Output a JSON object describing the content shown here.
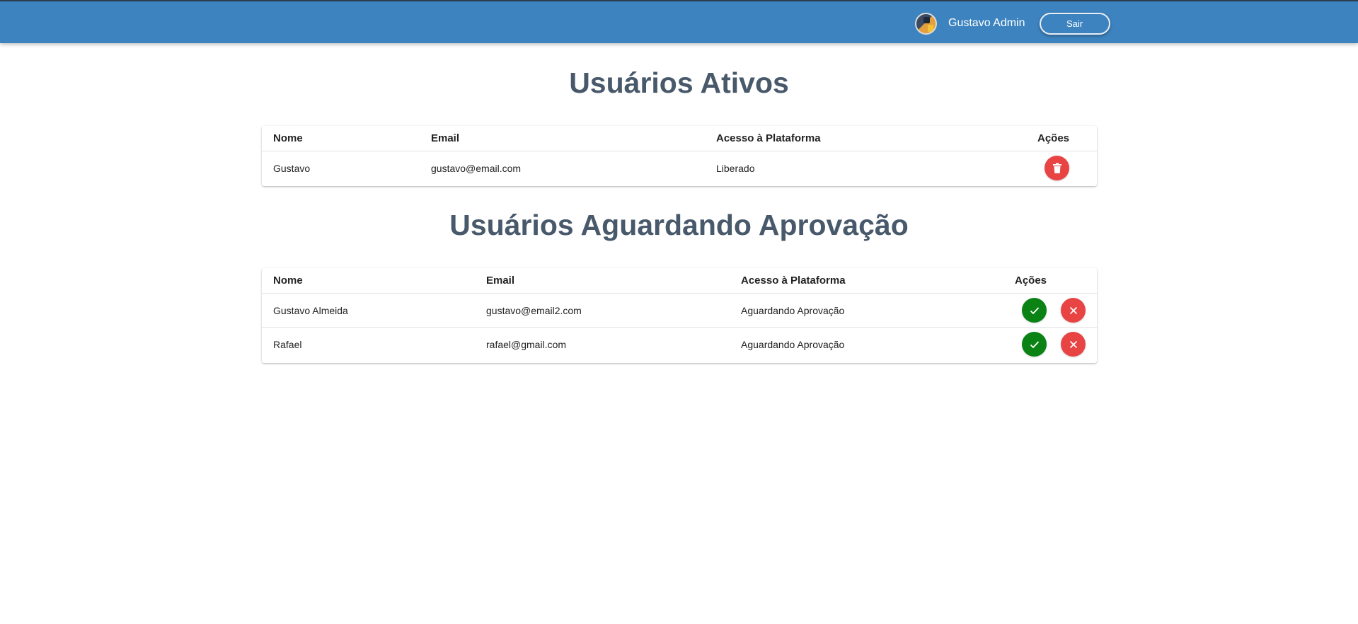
{
  "header": {
    "user_name": "Gustavo Admin",
    "logout_label": "Sair"
  },
  "active_users": {
    "title": "Usuários Ativos",
    "columns": [
      "Nome",
      "Email",
      "Acesso à Plataforma",
      "Ações"
    ],
    "rows": [
      {
        "name": "Gustavo",
        "email": "gustavo@email.com",
        "access": "Liberado"
      }
    ]
  },
  "pending_users": {
    "title": "Usuários Aguardando Aprovação",
    "columns": [
      "Nome",
      "Email",
      "Acesso à Plataforma",
      "Ações"
    ],
    "rows": [
      {
        "name": "Gustavo Almeida",
        "email": "gustavo@email2.com",
        "access": "Aguardando Aprovação"
      },
      {
        "name": "Rafael",
        "email": "rafael@gmail.com",
        "access": "Aguardando Aprovação"
      }
    ]
  },
  "colors": {
    "header_bg": "#3d83bf",
    "title_text": "#48596b",
    "delete_button": "#e84444",
    "approve_button": "#0a8214"
  },
  "icons": {
    "delete": "trash-icon",
    "approve": "check-icon",
    "reject": "close-icon"
  }
}
